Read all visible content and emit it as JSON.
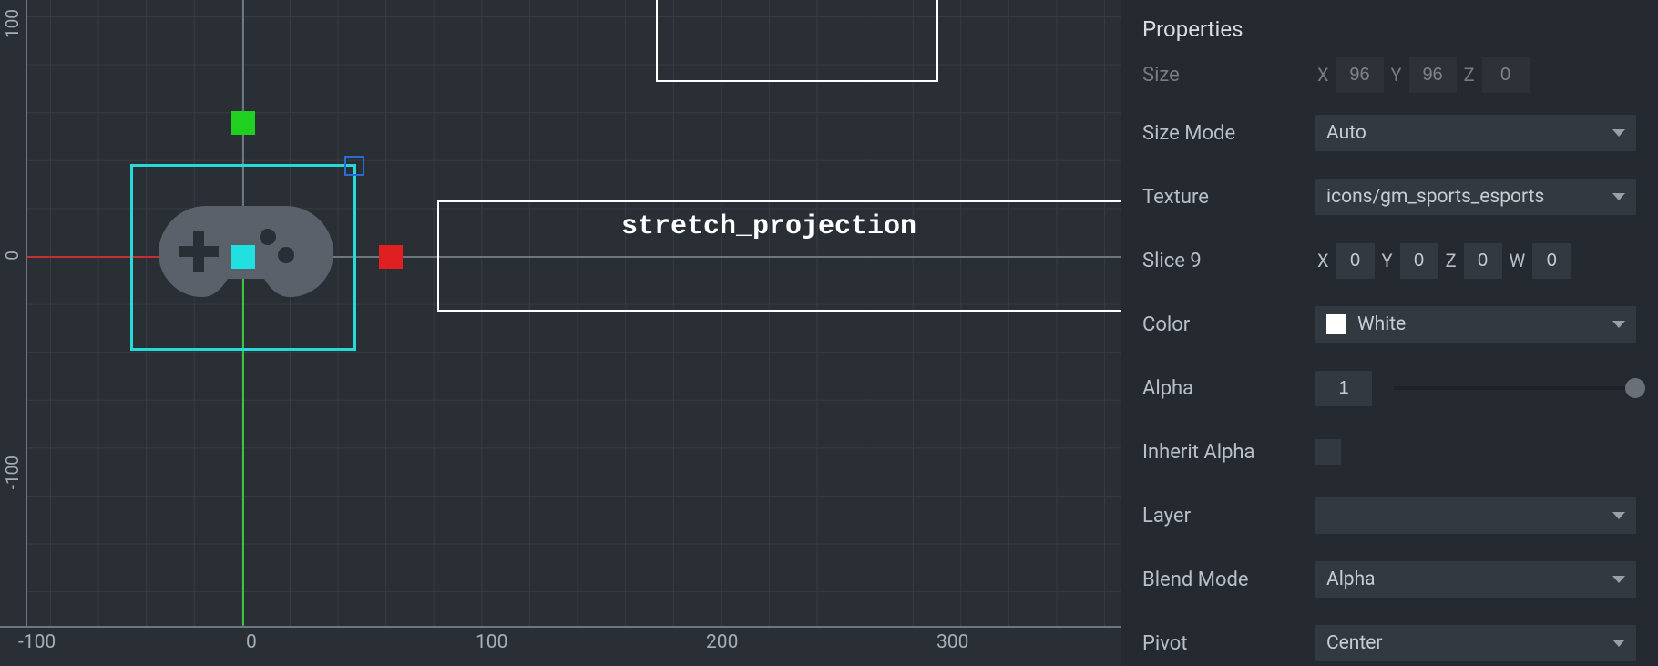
{
  "editor": {
    "node_label": "stretch_projection",
    "ruler_x": [
      "-100",
      "0",
      "100",
      "200",
      "300"
    ],
    "ruler_y_top": "100",
    "ruler_y_mid": "0",
    "ruler_y_bottom": "-100"
  },
  "panel": {
    "title": "Properties",
    "size": {
      "label": "Size",
      "xLab": "X",
      "yLab": "Y",
      "zLab": "Z",
      "x": "96",
      "y": "96",
      "z": "0"
    },
    "sizeMode": {
      "label": "Size Mode",
      "value": "Auto"
    },
    "texture": {
      "label": "Texture",
      "value": "icons/gm_sports_esports"
    },
    "slice9": {
      "label": "Slice 9",
      "xLab": "X",
      "yLab": "Y",
      "zLab": "Z",
      "wLab": "W",
      "x": "0",
      "y": "0",
      "z": "0",
      "w": "0"
    },
    "color": {
      "label": "Color",
      "value": "White"
    },
    "alpha": {
      "label": "Alpha",
      "value": "1"
    },
    "inheritAlpha": {
      "label": "Inherit Alpha"
    },
    "layer": {
      "label": "Layer",
      "value": ""
    },
    "blend": {
      "label": "Blend Mode",
      "value": "Alpha"
    },
    "pivot": {
      "label": "Pivot",
      "value": "Center"
    }
  }
}
